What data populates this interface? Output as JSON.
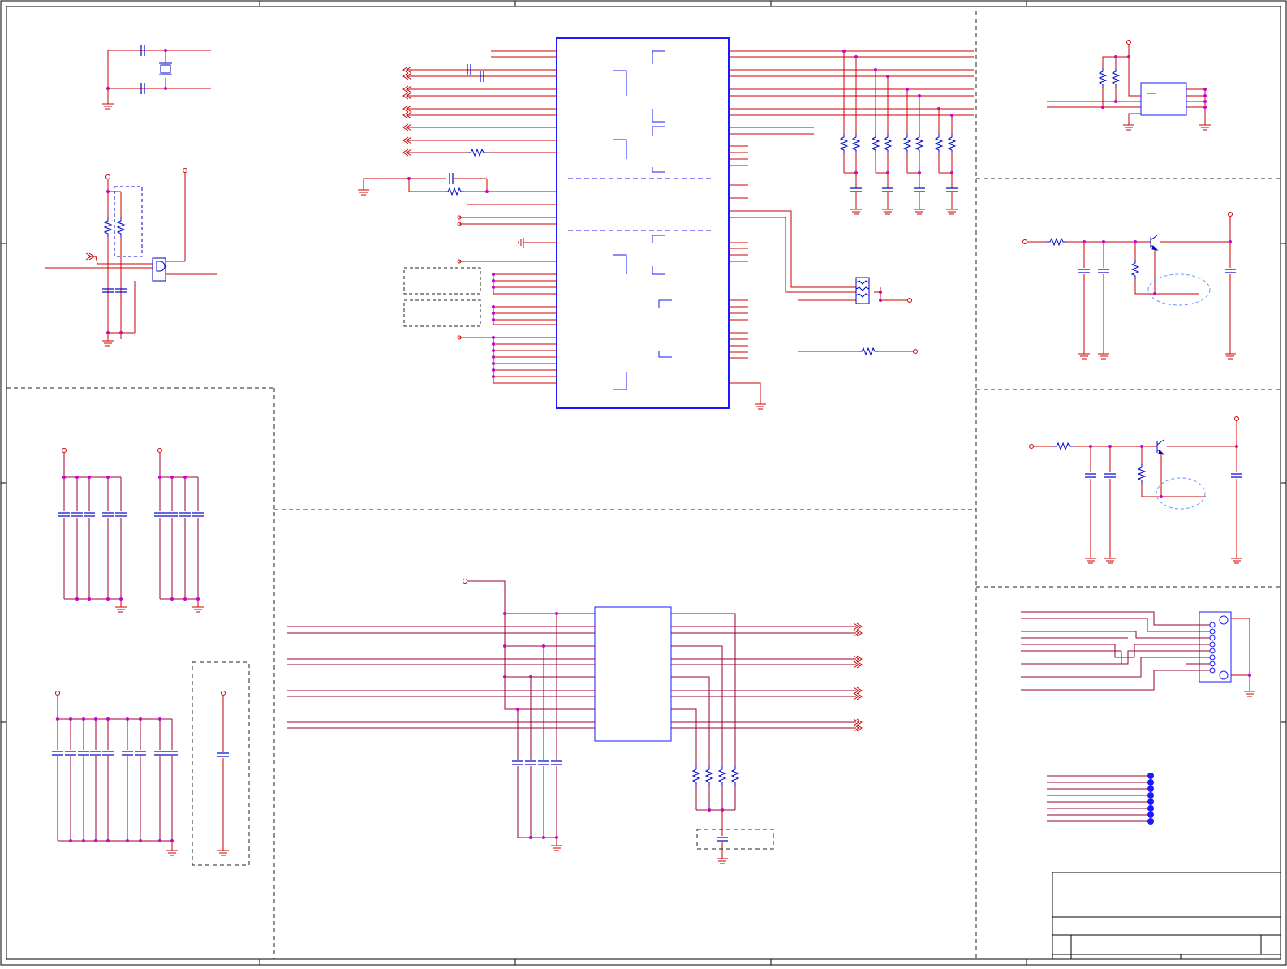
{
  "sheet": {
    "background": "#ffffff",
    "title_block_text": []
  },
  "colors": {
    "wire": "#cc0000",
    "wire_dark": "#990033",
    "component": "#0000cc",
    "ic_outline": "#1a1aff",
    "junction": "#cc00cc",
    "border": "#000000",
    "section_divider": "#222222",
    "annotation_ellipse": "#6699ff"
  },
  "icons": {
    "ground": "ground-symbol-icon",
    "power": "power-terminal-icon",
    "resistor": "resistor-icon",
    "capacitor": "capacitor-icon",
    "transistor": "npn-transistor-icon",
    "crystal": "crystal-icon",
    "connector": "db9-connector-icon",
    "offpage": "offpage-arrow-icon",
    "test_point": "test-point-icon"
  },
  "sections": [
    "crystal-oscillator",
    "reset-circuit",
    "main-controller-ic",
    "pullup-resistor-network",
    "eeprom-block",
    "led-driver-1",
    "led-driver-2",
    "decoupling-capacitors",
    "line-driver-ic",
    "serial-connector",
    "test-points",
    "title-block"
  ]
}
